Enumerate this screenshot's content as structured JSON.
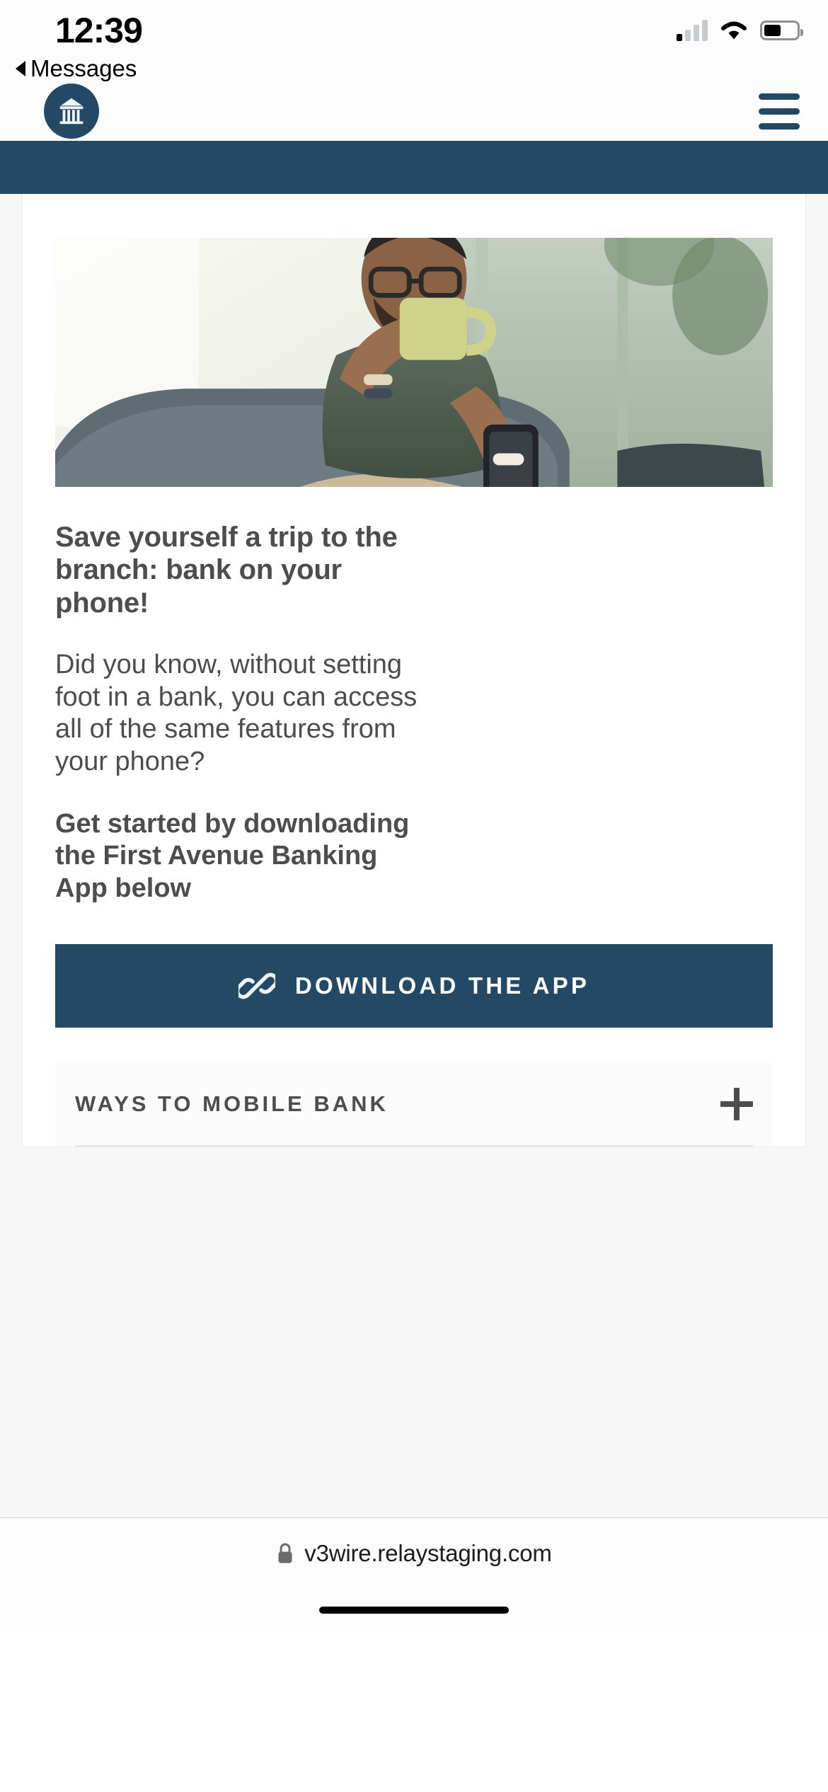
{
  "status_bar": {
    "time": "12:39",
    "back_label": "Messages",
    "icons": {
      "cellular": "signal-bars-icon",
      "wifi": "wifi-icon",
      "battery": "battery-icon"
    },
    "battery_level_pct": 52
  },
  "header": {
    "logo_icon": "bank-building-icon",
    "logo_alt": "First Avenue Banking",
    "menu_icon": "hamburger-menu-icon",
    "brand_color": "#244964"
  },
  "hero": {
    "image_alt": "Man drinking coffee on a couch while using his phone",
    "icon": "hero-photo"
  },
  "content": {
    "headline": "Save yourself a trip to the branch: bank on your phone!",
    "paragraph": "Did you know, without setting foot in a bank, you can access all of the same features from your phone?",
    "paragraph_bold": "Get started by downloading the First Avenue Banking App below"
  },
  "cta": {
    "label": "DOWNLOAD THE APP",
    "icon": "link-chain-icon",
    "background": "#244964",
    "text_color": "#ffffff"
  },
  "accordion": {
    "items": [
      {
        "title": "WAYS TO MOBILE BANK",
        "toggle_icon": "plus-icon",
        "expanded": false
      }
    ]
  },
  "browser_bar": {
    "lock_icon": "lock-icon",
    "url": "v3wire.relaystaging.com",
    "home_indicator": "home-indicator"
  },
  "colors": {
    "navy": "#244964",
    "text_gray": "#4d4d4d",
    "page_bg": "#f7f7f7",
    "card_bg": "#ffffff"
  }
}
